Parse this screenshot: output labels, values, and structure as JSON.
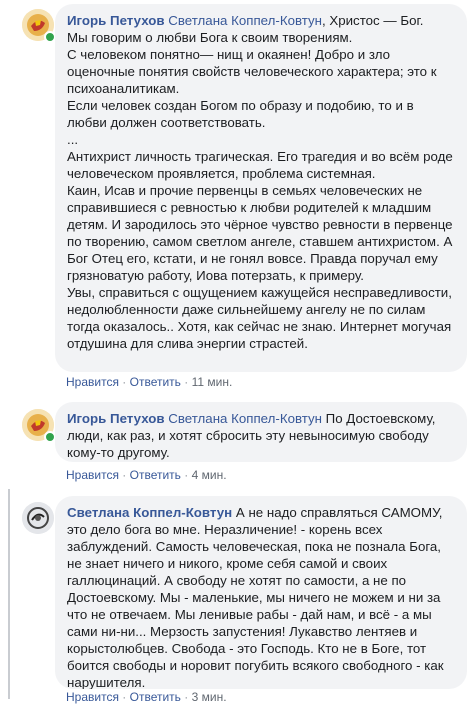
{
  "comments": [
    {
      "author": "Игорь Петухов",
      "mention": "Светлана Коппел-Ковтун",
      "first_line_rest": ", Христос — Бог.",
      "paragraphs": [
        "Мы говорим о любви Бога к своим творениям.",
        "С человеком понятно— нищ и окаянен! Добро и зло оценочные понятия свойств человеческого характера; это к психоаналитикам.",
        "Если человек создан Богом по образу и подобию, то и в любви должен соответствовать.",
        "...",
        "Антихрист личность трагическая. Его трагедия и во всём роде человеческом проявляется, проблема системная.",
        "Каин, Исав и прочие первенцы в семьях человеческих не справившиеся с ревностью к любви родителей к младшим детям. И зародилось это чёрное чувство ревности в первенце по творению, самом светлом ангеле, ставшем антихристом. А Бог Отец его, кстати, и не гонял вовсе. Правда поручал ему грязноватую работу, Иова потерзать, к примеру.",
        "Увы, справиться с ощущением кажущейся несправедливости, недолюбленности даже сильнейшему ангелу не по силам тогда оказалось.. Хотя, как сейчас не знаю. Интернет могучая отдушина для слива энергии страстей."
      ],
      "like_label": "Нравится",
      "reply_label": "Ответить",
      "separator": "·",
      "time": "11 мин."
    },
    {
      "author": "Игорь Петухов",
      "mention": "Светлана Коппел-Ковтун",
      "first_line_rest": " По Достоевскому, люди, как раз, и хотят сбросить эту невыносимую свободу кому-то другому.",
      "paragraphs": [],
      "like_label": "Нравится",
      "reply_label": "Ответить",
      "separator": "·",
      "time": "4 мин."
    },
    {
      "author": "Светлана Коппел-Ковтун",
      "mention": "",
      "first_line_rest": " А не надо справляться САМОМУ, это дело бога во мне. Неразличение! - корень всех заблуждений. Самость человеческая, пока не познала Бога, не знает ничего и никого, кроме себя самой и своих галлюцинаций. А свободу не хотят по самости, а не по Достоевскому. Мы - маленькие, мы ничего не можем и ни за что не отвечаем. Мы ленивые рабы - дай нам, и всё - а мы сами ни-ни... Мерзость запустения! Лукавство лентяев и корыстолюбцев. Свобода - это Господь. Кто не в Боге, тот боится свободы и норовит погубить всякого свободного - как нарушителя.",
      "paragraphs": [],
      "like_label": "Нравится",
      "reply_label": "Ответить",
      "separator": "·",
      "time": "3 мин."
    }
  ]
}
